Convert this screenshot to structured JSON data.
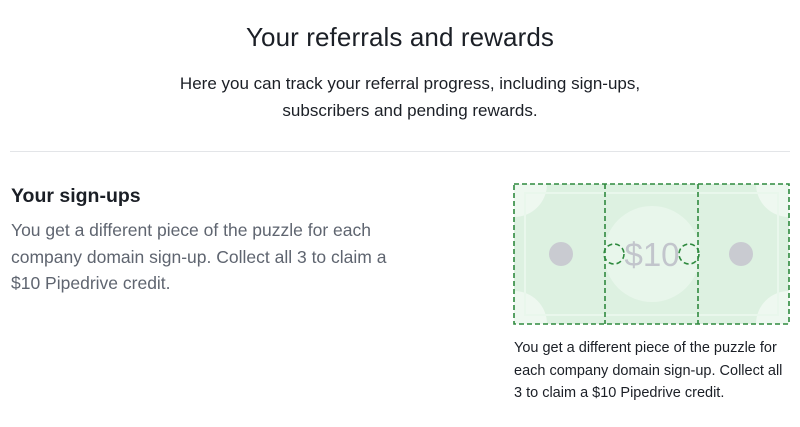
{
  "header": {
    "title": "Your referrals and rewards",
    "subtitle": "Here you can track your referral progress, including sign-ups, subscribers and pending rewards."
  },
  "signups": {
    "title": "Your sign-ups",
    "description": "You get a different piece of the puzzle for each company domain sign-up. Collect all 3 to claim a $10 Pipedrive credit.",
    "bill_amount": "$10",
    "caption": "You get a different piece of the puzzle for each company domain sign-up. Collect all 3 to claim a $10 Pipedrive credit."
  },
  "colors": {
    "bill_fill": "#ddf1e1",
    "bill_corner": "#eef8f0",
    "bill_center": "#e8f6eb",
    "dashed_border": "#2f8a3f",
    "dots": "#c9cbd1",
    "amount_text": "#c2c5cc"
  }
}
